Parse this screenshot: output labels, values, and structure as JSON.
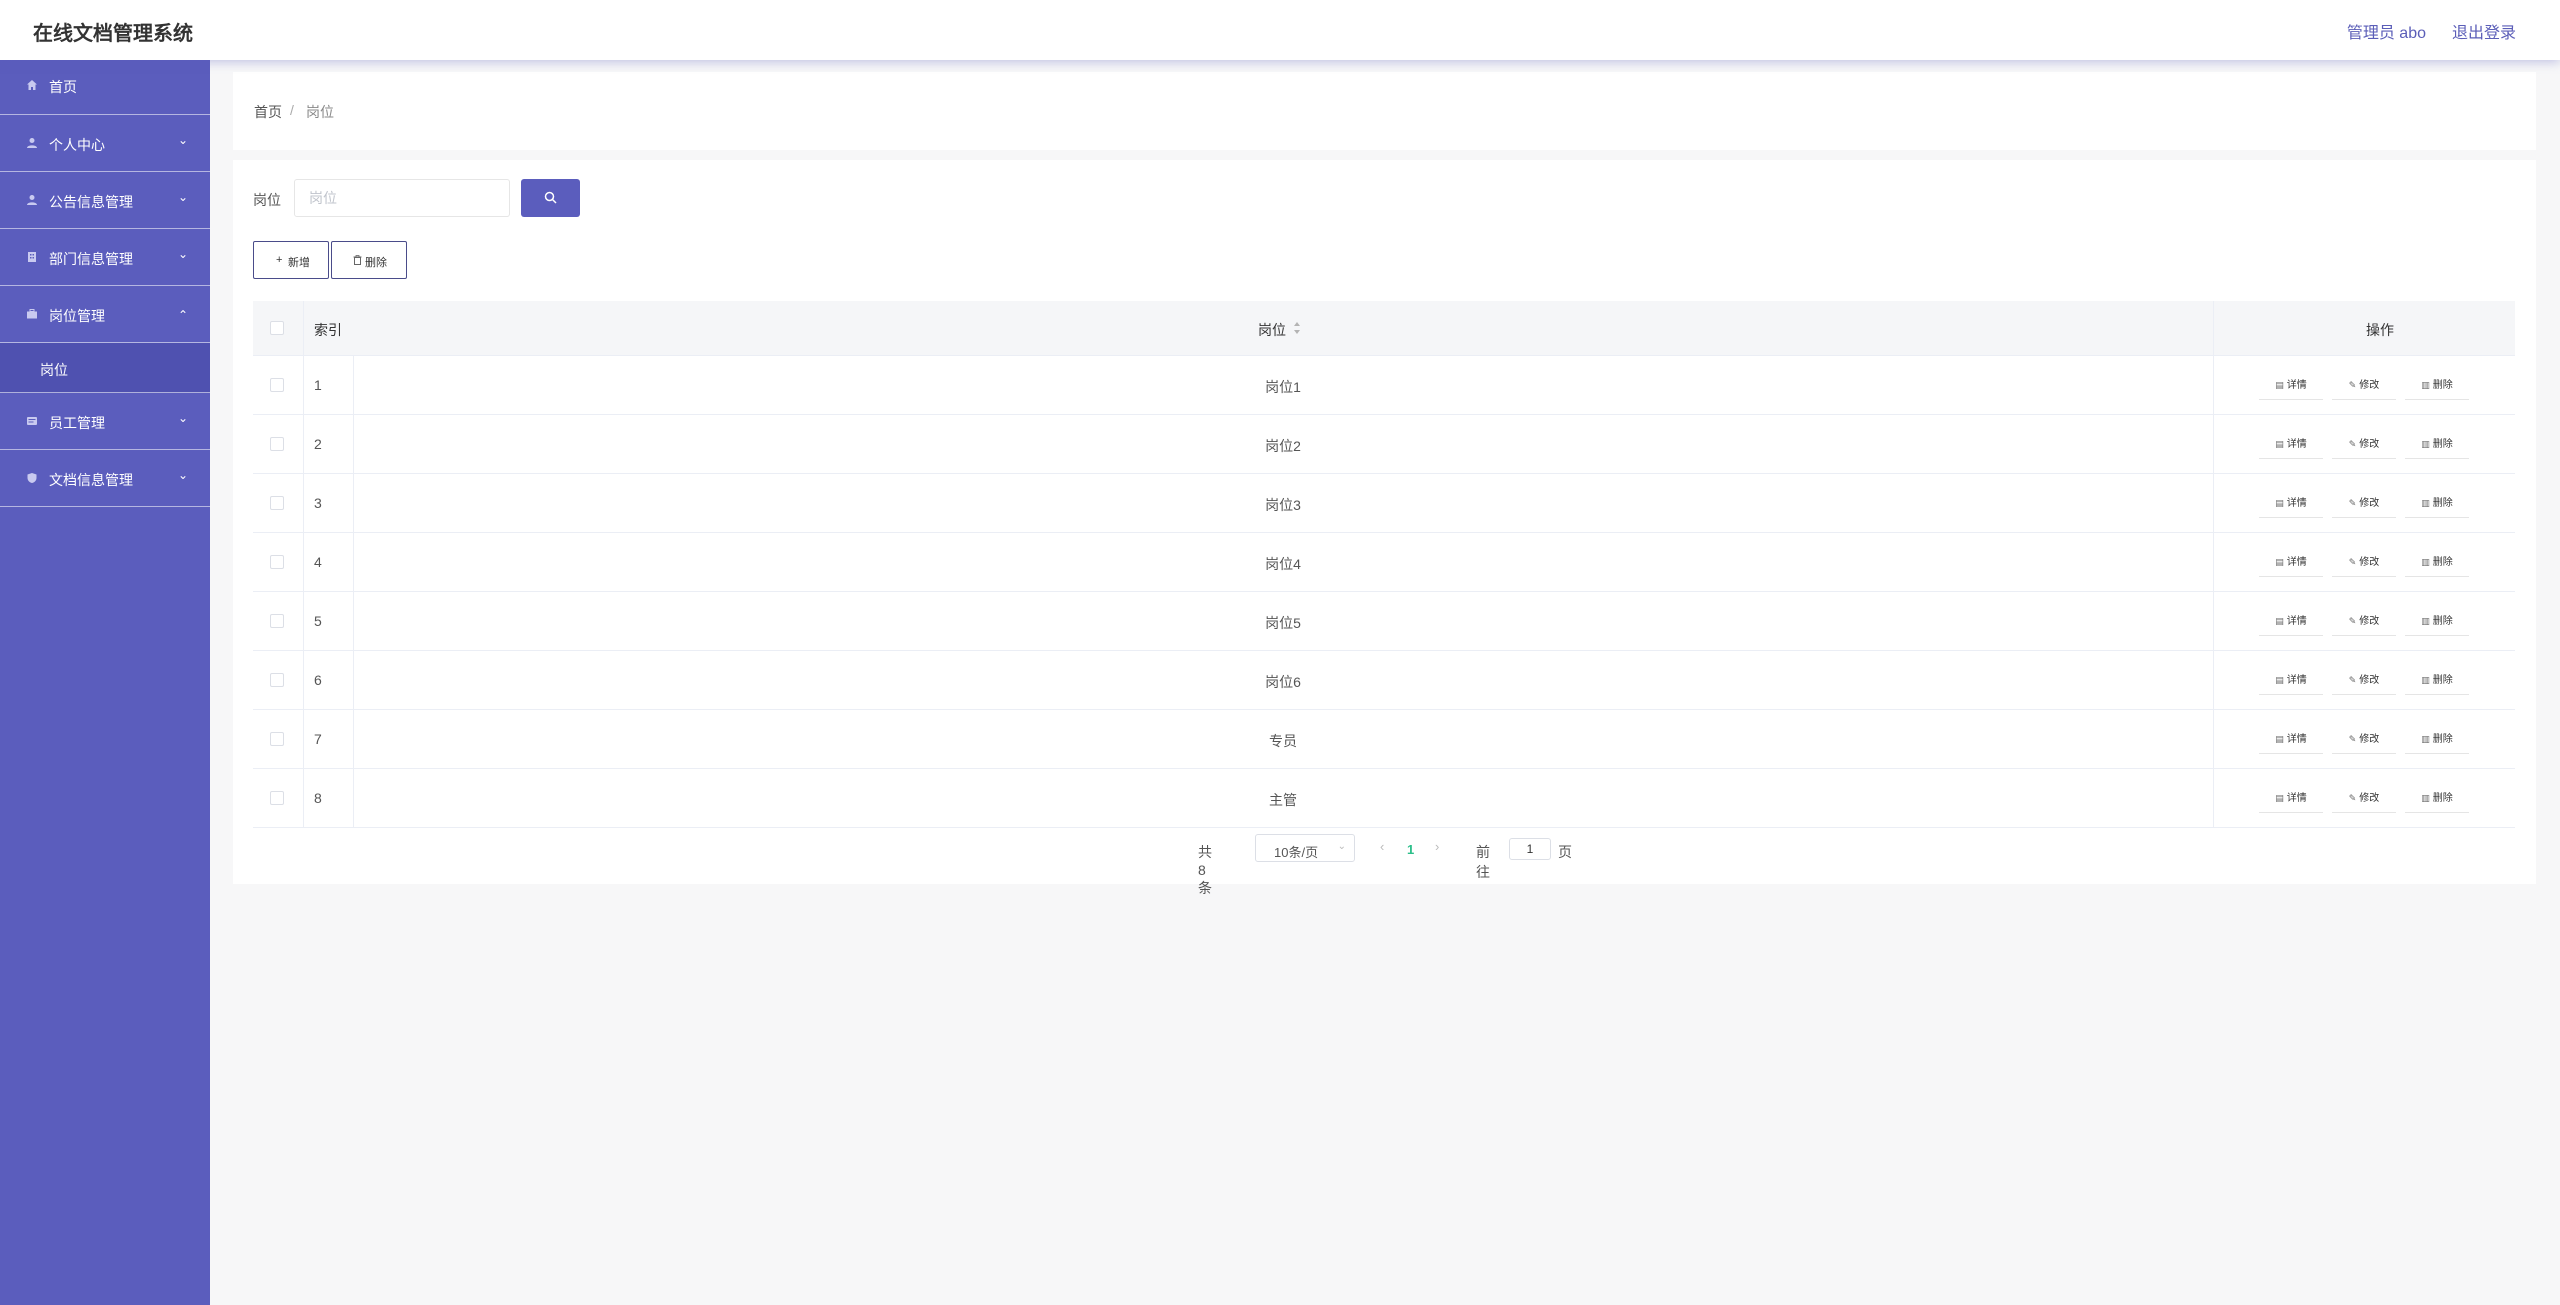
{
  "header": {
    "app_title": "在线文档管理系统",
    "user": "管理员 abo",
    "logout": "退出登录"
  },
  "sidebar": {
    "items": [
      {
        "label": "首页",
        "icon": "home-icon"
      },
      {
        "label": "个人中心",
        "icon": "user-icon"
      },
      {
        "label": "公告信息管理",
        "icon": "user-icon"
      },
      {
        "label": "部门信息管理",
        "icon": "building-icon"
      },
      {
        "label": "岗位管理",
        "icon": "briefcase-icon"
      },
      {
        "label": "员工管理",
        "icon": "id-card-icon"
      },
      {
        "label": "文档信息管理",
        "icon": "shield-icon"
      }
    ],
    "sub_item": "岗位"
  },
  "breadcrumb": {
    "home": "首页",
    "separator": "/",
    "current": "岗位"
  },
  "search": {
    "label": "岗位",
    "placeholder": "岗位",
    "value": ""
  },
  "toolbar": {
    "add_label": "新增",
    "add_icon": "+",
    "delete_label": "删除"
  },
  "table": {
    "headers": {
      "index": "索引",
      "position": "岗位",
      "operation": "操作"
    },
    "actions": {
      "detail": "详情",
      "edit": "修改",
      "delete": "删除"
    },
    "rows": [
      {
        "index": "1",
        "position": "岗位1"
      },
      {
        "index": "2",
        "position": "岗位2"
      },
      {
        "index": "3",
        "position": "岗位3"
      },
      {
        "index": "4",
        "position": "岗位4"
      },
      {
        "index": "5",
        "position": "岗位5"
      },
      {
        "index": "6",
        "position": "岗位6"
      },
      {
        "index": "7",
        "position": "专员"
      },
      {
        "index": "8",
        "position": "主管"
      }
    ]
  },
  "pagination": {
    "total": "共 8 条",
    "page_size": "10条/页",
    "current_page": "1",
    "goto_label": "前往",
    "goto_value": "1",
    "page_suffix": "页"
  },
  "colors": {
    "accent": "#5b5dbd",
    "active_page": "#2cbf8a"
  }
}
